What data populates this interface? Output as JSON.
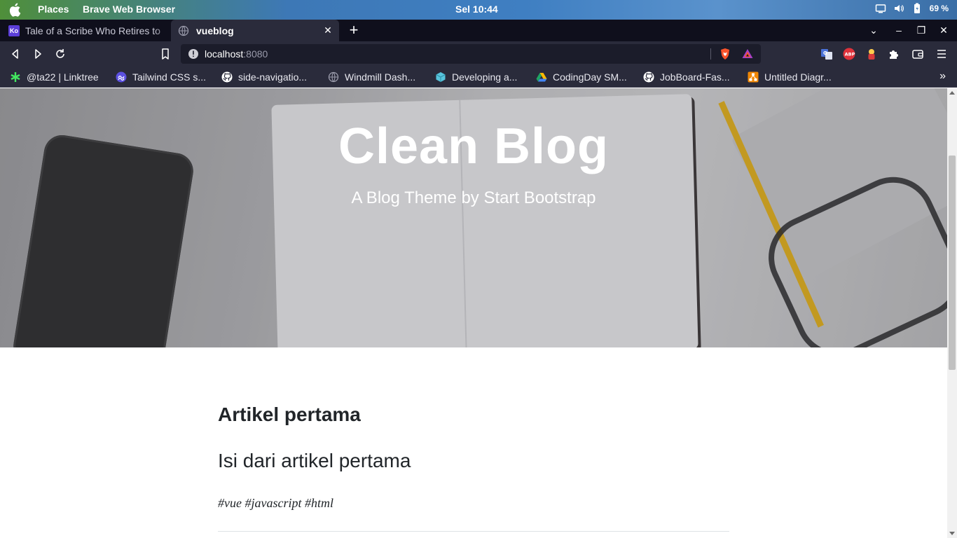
{
  "os": {
    "menu_places": "Places",
    "menu_app": "Brave Web Browser",
    "clock": "Sel 10:44",
    "battery": "69 %"
  },
  "tabs": [
    {
      "favicon_text": "Ko",
      "title": "Tale of a Scribe Who Retires to",
      "active": false
    },
    {
      "title": "vueblog",
      "active": true
    }
  ],
  "toolbar": {
    "url_host": "localhost",
    "url_port": ":8080"
  },
  "bookmarks": [
    {
      "label": "@ta22 | Linktree",
      "icon": "linktree-icon"
    },
    {
      "label": "Tailwind CSS s...",
      "icon": "tailwind-icon"
    },
    {
      "label": "side-navigatio...",
      "icon": "github-icon"
    },
    {
      "label": "Windmill Dash...",
      "icon": "globe-icon"
    },
    {
      "label": "Developing a...",
      "icon": "cube-icon"
    },
    {
      "label": "CodingDay SM...",
      "icon": "google-drive-icon"
    },
    {
      "label": "JobBoard-Fas...",
      "icon": "github-icon"
    },
    {
      "label": "Untitled Diagr...",
      "icon": "drawio-icon"
    }
  ],
  "hero": {
    "title": "Clean Blog",
    "subtitle": "A Blog Theme by Start Bootstrap"
  },
  "post": {
    "title": "Artikel pertama",
    "body": "Isi dari artikel pertama",
    "tags": "#vue #javascript #html"
  },
  "colors": {
    "tab_strip": "#0f0f1c",
    "toolbar": "#2a2b3b",
    "brave_orange": "#fb542b"
  },
  "scroll": {
    "position_fraction": 0.15
  }
}
